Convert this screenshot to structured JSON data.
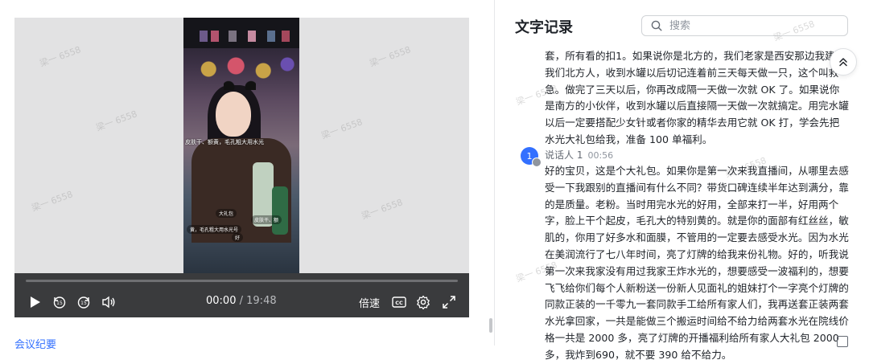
{
  "player": {
    "current_time": "00:00",
    "separator": "/",
    "duration": "19:48",
    "speed_label": "倍速",
    "cc_label": "CC",
    "video_captions": {
      "line1": "皮肤干、额黄，毛孔粗大用水光",
      "line2": "大礼包",
      "line3": "皮肤干、额",
      "line4": "黄，毛孔粗大用水光号",
      "line5": "好"
    }
  },
  "watermark_text": "梁一 6558",
  "left_link": "会议纪要",
  "panel": {
    "title": "文字记录",
    "search_placeholder": "搜索"
  },
  "transcript": {
    "para1": "套，所有看的扣1。如果说你是北方的，我们老家是西安那边我建议我们北方人，收到水罐以后切记连着前三天每天做一只，这个叫救急。做完了三天以后，你再改成隔一天做一次就 OK 了。如果说你是南方的小伙伴，收到水罐以后直接隔一天做一次就搞定。用完水罐以后一定要搭配少女针或者你家的精华去用它就 OK 打，学会先把水光大礼包给我，准备 100 单福利。",
    "speaker_avatar": "1",
    "speaker_name": "说话人 1",
    "speaker_time": "00:56",
    "para2": "好的宝贝，这是个大礼包。如果你是第一次来我直播间，从哪里去感受一下我跟别的直播间有什么不同？带货口碑连续半年达到满分，靠的是质量。老粉。当时用完水光的好用，全部来打一半，好用两个字，脸上干个起皮，毛孔大的特别黄的。就是你的面部有红丝丝，敏肌的，你用了好多水和面膜，不管用的一定要去感受水光。因为水光在美润流行了七八年时间，亮了灯牌的给我来份礼物。好的，听我说第一次来我家没有用过我家王炸水光的，想要感受一波福利的，想要飞飞给你们每个人新粉送一份新人见面礼的姐妹打个一字亮个灯牌的同款正装的一千零九一套同款手工给所有家人们，我再送套正装两套水光拿回家，一共是能做三个搬运时间给不给力给两套水光在院线价格一共是 2000 多，亮了灯牌的开播福利给所有家人大礼包 2000 多，我炸到690，就不要 390 给不给力。"
  },
  "colors": {
    "accent": "#3370ff",
    "control_bar": "#3a3b3d",
    "player_bg": "#e2e2e3"
  }
}
